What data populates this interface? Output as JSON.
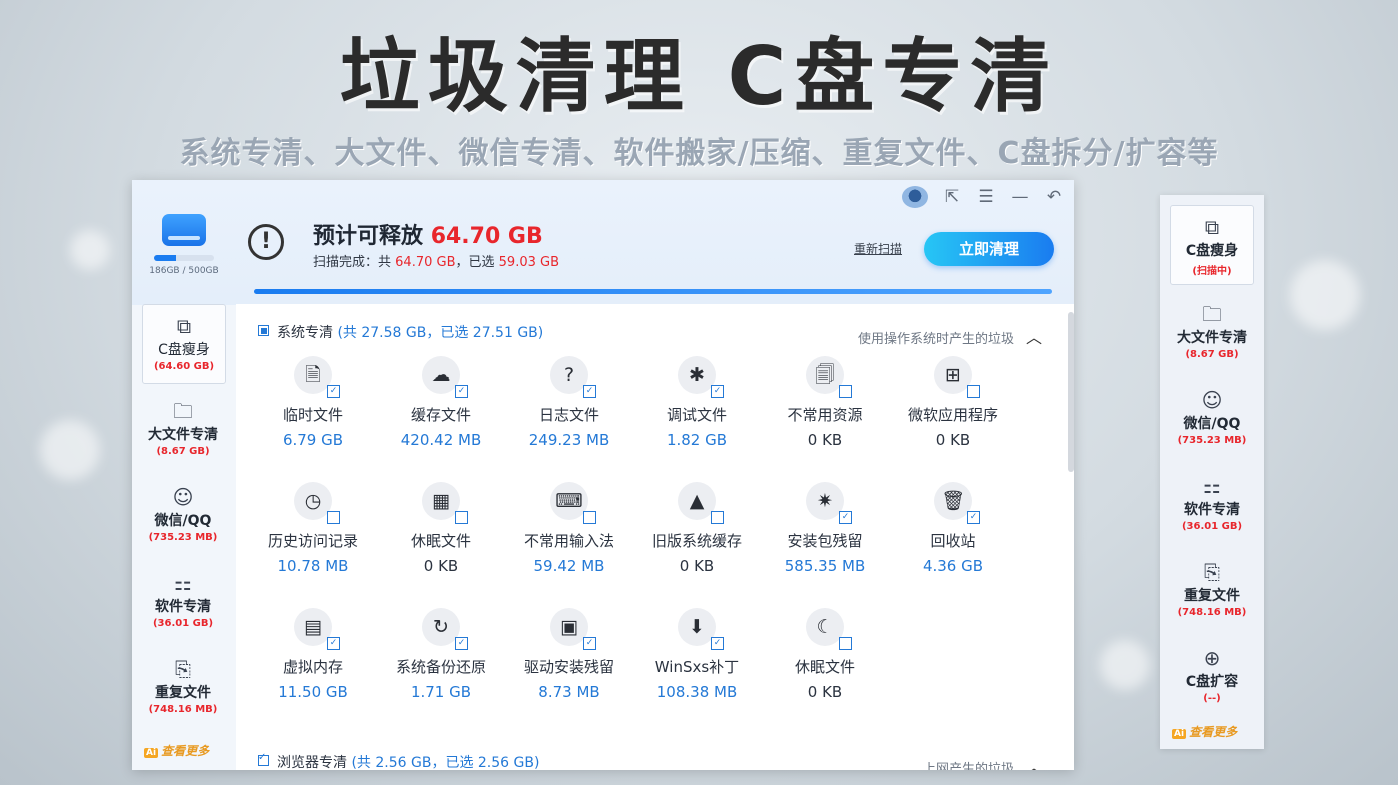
{
  "banner": {
    "title": "垃圾清理 C盘专清",
    "subtitle": "系统专清、大文件、微信专清、软件搬家/压缩、重复文件、C盘拆分/扩容等"
  },
  "drive": {
    "label": "186GB / 500GB",
    "used_fraction": 0.372
  },
  "estimate": {
    "title": "预计可释放",
    "amount": "64.70 GB",
    "scan_prefix": "扫描完成：共",
    "scan_total": "64.70 GB",
    "scan_mid": "，已选",
    "scan_selected": "59.03 GB",
    "progress": 1.0
  },
  "actions": {
    "rescan": "重新扫描",
    "clean_now": "立即清理"
  },
  "sidebar": {
    "items": [
      {
        "icon": "cdrive-slim-icon",
        "label": "C盘瘦身",
        "value": "(64.60 GB)"
      },
      {
        "icon": "folder-icon",
        "label": "大文件专清",
        "value": "(8.67 GB)"
      },
      {
        "icon": "wechat-icon",
        "label": "微信/QQ",
        "value": "(735.23 MB)"
      },
      {
        "icon": "apps-icon",
        "label": "软件专清",
        "value": "(36.01 GB)"
      },
      {
        "icon": "duplicate-icon",
        "label": "重复文件",
        "value": "(748.16 MB)"
      }
    ],
    "more": "查看更多",
    "ai_badge": "Ai"
  },
  "sections": [
    {
      "title": "系统专清",
      "summary": "(共 27.58 GB，已选 27.51 GB)",
      "note": "使用操作系统时产生的垃圾",
      "items": [
        {
          "icon": "temp-file-icon",
          "name": "临时文件",
          "size": "6.79 GB",
          "checked": true
        },
        {
          "icon": "cloud-download-icon",
          "name": "缓存文件",
          "size": "420.42 MB",
          "checked": true
        },
        {
          "icon": "log-file-icon",
          "name": "日志文件",
          "size": "249.23 MB",
          "checked": true
        },
        {
          "icon": "bug-icon",
          "name": "调试文件",
          "size": "1.82 GB",
          "checked": true
        },
        {
          "icon": "unused-resource-icon",
          "name": "不常用资源",
          "size": "0 KB",
          "checked": false
        },
        {
          "icon": "windows-icon",
          "name": "微软应用程序",
          "size": "0 KB",
          "checked": false
        },
        {
          "icon": "history-icon",
          "name": "历史访问记录",
          "size": "10.78 MB",
          "checked": false
        },
        {
          "icon": "hibernate-tiles-icon",
          "name": "休眠文件",
          "size": "0 KB",
          "checked": false
        },
        {
          "icon": "keyboard-icon",
          "name": "不常用输入法",
          "size": "59.42 MB",
          "checked": false
        },
        {
          "icon": "old-system-icon",
          "name": "旧版系统缓存",
          "size": "0 KB",
          "checked": false
        },
        {
          "icon": "package-bug-icon",
          "name": "安装包残留",
          "size": "585.35 MB",
          "checked": true
        },
        {
          "icon": "recycle-bin-icon",
          "name": "回收站",
          "size": "4.36 GB",
          "checked": true
        },
        {
          "icon": "virtual-memory-icon",
          "name": "虚拟内存",
          "size": "11.50 GB",
          "checked": true
        },
        {
          "icon": "backup-restore-icon",
          "name": "系统备份还原",
          "size": "1.71 GB",
          "checked": true
        },
        {
          "icon": "driver-icon",
          "name": "驱动安装残留",
          "size": "8.73 MB",
          "checked": true
        },
        {
          "icon": "winsxs-icon",
          "name": "WinSxs补丁",
          "size": "108.38 MB",
          "checked": true
        },
        {
          "icon": "sleep-moon-icon",
          "name": "休眠文件",
          "size": "0 KB",
          "checked": false
        }
      ]
    },
    {
      "title": "浏览器专清",
      "summary": "(共 2.56 GB，已选 2.56 GB)",
      "note": "上网产生的垃圾"
    }
  ],
  "mini_panel": {
    "items": [
      {
        "icon": "cdrive-slim-icon",
        "label": "C盘瘦身",
        "value": "(扫描中)"
      },
      {
        "icon": "folder-icon",
        "label": "大文件专清",
        "value": "(8.67 GB)"
      },
      {
        "icon": "wechat-icon",
        "label": "微信/QQ",
        "value": "(735.23 MB)"
      },
      {
        "icon": "apps-icon",
        "label": "软件专清",
        "value": "(36.01 GB)"
      },
      {
        "icon": "duplicate-icon",
        "label": "重复文件",
        "value": "(748.16 MB)"
      },
      {
        "icon": "disk-expand-icon",
        "label": "C盘扩容",
        "value": "(--)"
      }
    ],
    "more": "查看更多",
    "ai_badge": "Ai"
  },
  "colors": {
    "accent": "#2479d6",
    "highlight": "#e8262c",
    "button_start": "#27c6f5",
    "button_end": "#1a7cf0"
  }
}
